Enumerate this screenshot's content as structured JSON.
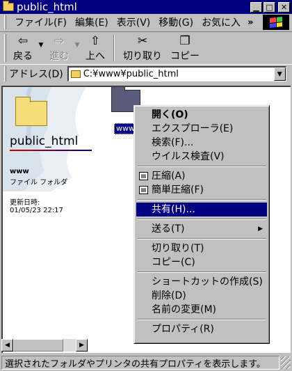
{
  "window": {
    "title": "public_html"
  },
  "menubar": {
    "items": [
      "ファイル(F)",
      "編集(E)",
      "表示(V)",
      "移動(G)",
      "お気に入"
    ],
    "more": "»"
  },
  "toolbar": {
    "back": {
      "label": "戻る",
      "icon": "back-arrow-icon"
    },
    "forward": {
      "label": "進む",
      "icon": "forward-arrow-icon",
      "disabled": true
    },
    "up": {
      "label": "上へ",
      "icon": "up-folder-icon"
    },
    "cut": {
      "label": "切り取り",
      "icon": "scissors-icon"
    },
    "copy": {
      "label": "コピー",
      "icon": "copy-icon"
    }
  },
  "address": {
    "label": "アドレス(D)",
    "value": "C:¥www¥public_html"
  },
  "left_pane": {
    "title": "public_html",
    "item_name": "www",
    "item_type": "ファイル フォルダ",
    "modified_label": "更新日時:",
    "modified_value": "01/05/23 22:17"
  },
  "selected_folder": {
    "label": "www"
  },
  "context_menu": {
    "items": [
      {
        "label": "開く(O)",
        "bold": true
      },
      {
        "label": "エクスプローラ(E)"
      },
      {
        "label": "検索(F)..."
      },
      {
        "label": "ウイルス検査(V)"
      },
      {
        "label": "圧縮(A)",
        "icon": "compress-icon"
      },
      {
        "label": "簡単圧縮(F)",
        "icon": "compress-icon"
      },
      {
        "label": "共有(H)...",
        "highlighted": true
      },
      {
        "label": "送る(T)",
        "submenu": true
      },
      {
        "label": "切り取り(T)"
      },
      {
        "label": "コピー(C)"
      },
      {
        "label": "ショートカットの作成(S)"
      },
      {
        "label": "削除(D)"
      },
      {
        "label": "名前の変更(M)"
      },
      {
        "label": "プロパティ(R)"
      }
    ]
  },
  "statusbar": {
    "text": "選択されたフォルダやプリンタの共有プロパティを表示します。"
  },
  "colors": {
    "titlebar": "#000080",
    "highlight": "#000080",
    "face": "#c0c0c0"
  }
}
